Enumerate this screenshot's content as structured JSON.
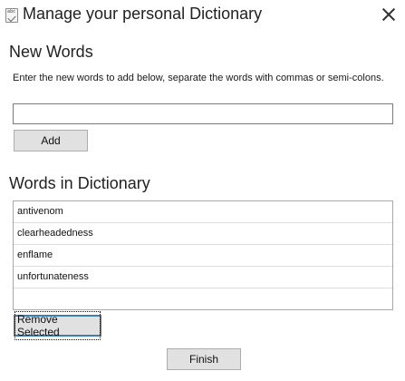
{
  "window": {
    "title": "Manage your personal Dictionary",
    "icon": "dictionary-icon",
    "icon_text": "abc",
    "close_icon": "close-icon"
  },
  "new_words": {
    "heading": "New Words",
    "instructions": "Enter the new words to add below, separate the words with commas or semi-colons.",
    "input_value": "",
    "add_label": "Add"
  },
  "dictionary": {
    "heading": "Words in Dictionary",
    "words": [
      "antivenom",
      "clearheadedness",
      "enflame",
      "unfortunateness"
    ],
    "remove_label": "Remove Selected"
  },
  "footer": {
    "finish_label": "Finish"
  },
  "colors": {
    "focus_border": "#3c7fb1",
    "button_bg": "#e1e1e1"
  }
}
